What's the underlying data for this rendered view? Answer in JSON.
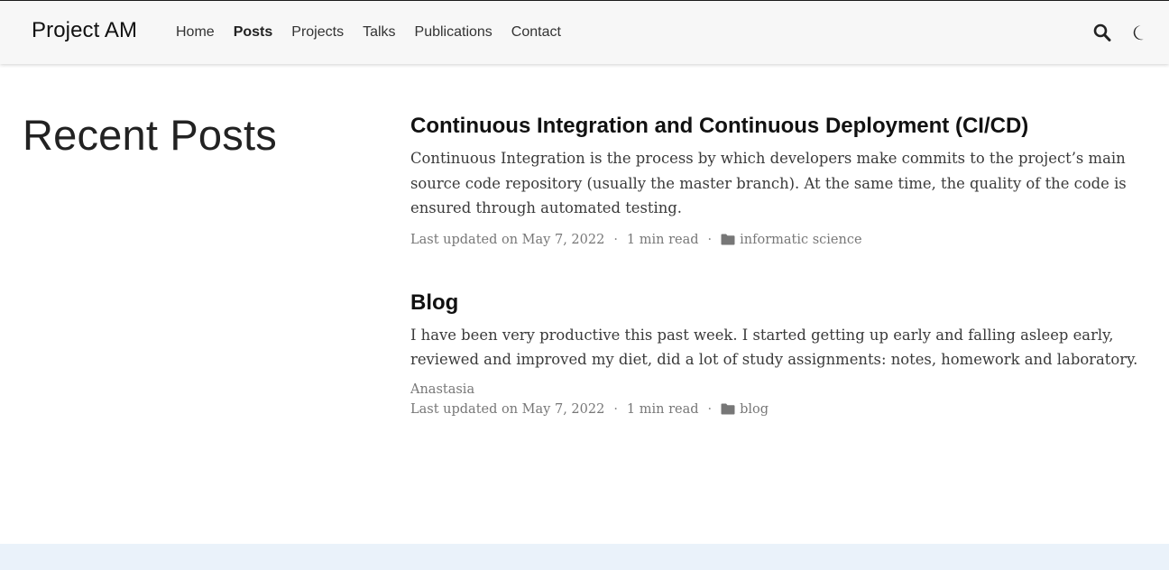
{
  "navbar": {
    "brand": "Project AM",
    "links": [
      {
        "label": "Home"
      },
      {
        "label": "Posts",
        "active": true
      },
      {
        "label": "Projects"
      },
      {
        "label": "Talks"
      },
      {
        "label": "Publications"
      },
      {
        "label": "Contact"
      }
    ],
    "icons": [
      "search-icon",
      "moon-icon"
    ]
  },
  "page": {
    "title": "Recent Posts"
  },
  "posts": [
    {
      "title": "Continuous Integration and Continuous Deployment (CI/CD)",
      "summary": "Continuous Integration is the process by which developers make commits to the project’s main source code repository (usually the master branch). At the same time, the quality of the code is ensured through automated testing.",
      "updated": "Last updated on May 7, 2022",
      "read_time": "1 min read",
      "category": "informatic science"
    },
    {
      "title": "Blog",
      "summary": "I have been very productive this past week. I started getting up early and falling asleep early, reviewed and improved my diet, did a lot of study assignments: notes, homework and laboratory.",
      "author": "Anastasia",
      "updated": "Last updated on May 7, 2022",
      "read_time": "1 min read",
      "category": "blog"
    }
  ],
  "colors": {
    "navbar_bg": "#f7f7f7",
    "footer_band": "#eaf2fa",
    "meta_text": "#777777"
  }
}
